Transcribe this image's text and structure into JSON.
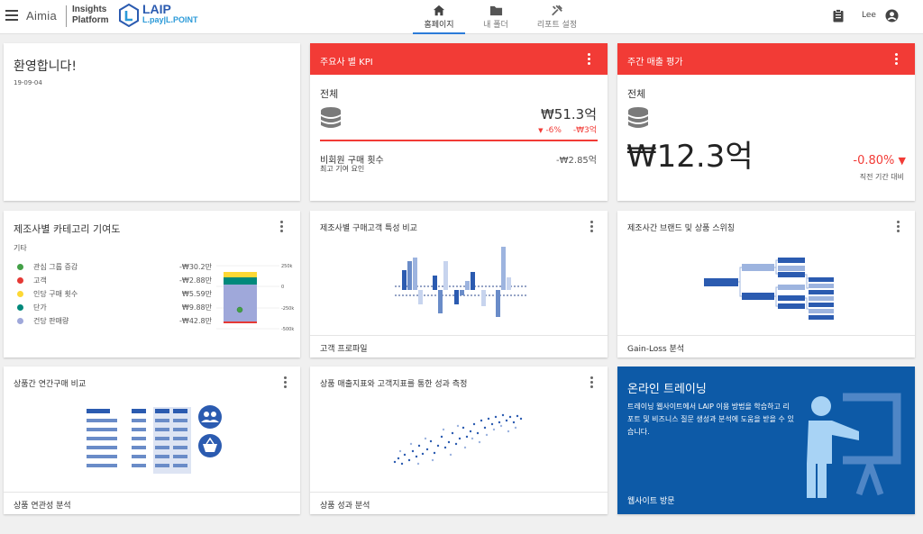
{
  "header": {
    "brand_left": "Aimia",
    "brand_mid_line1": "Insights",
    "brand_mid_line2": "Platform",
    "logo_title": "LAIP",
    "logo_sub": "L.pay|L.POINT",
    "tabs": [
      {
        "label": "홈페이지",
        "icon": "home-icon",
        "active": true
      },
      {
        "label": "내 폴더",
        "icon": "folder-icon",
        "active": false
      },
      {
        "label": "리포트 설정",
        "icon": "report-settings-icon",
        "active": false
      }
    ],
    "user": "Lee"
  },
  "welcome": {
    "title": "환영합니다!",
    "date": "19-09-04"
  },
  "kpi": {
    "title": "주요사 별 KPI",
    "scope": "전체",
    "value": "₩51.3억",
    "change_pct": "-6%",
    "change_abs": "-₩3억",
    "metric_label": "비회원 구매 횟수",
    "metric_value": "-₩2.85억",
    "metric_sub": "최고 기여 요인"
  },
  "weekly": {
    "title": "주간 매출 평가",
    "scope": "전체",
    "value": "₩12.3억",
    "change": "-0.80%",
    "compare": "직전 기간 대비"
  },
  "category": {
    "title": "제조사별 카테고리 기여도",
    "subtitle": "기타",
    "items": [
      {
        "label": "관심 그룹 증감",
        "value": "-₩30.2만",
        "color": "#43a047"
      },
      {
        "label": "고객",
        "value": "-₩2.88만",
        "color": "#e53935"
      },
      {
        "label": "인당 구매 횟수",
        "value": "₩5.59만",
        "color": "#fdd835"
      },
      {
        "label": "단가",
        "value": "₩9.88만",
        "color": "#00897b"
      },
      {
        "label": "건당 판매량",
        "value": "-₩42.8만",
        "color": "#9fa8da"
      }
    ],
    "axis": [
      "250k",
      "0",
      "-250k",
      "-500k"
    ]
  },
  "customer_compare": {
    "title": "제조사별 구매고객 특성 비교",
    "footer": "고객 프로파일"
  },
  "brand_switch": {
    "title": "제조사간 브랜드 및 상품 스위칭",
    "footer": "Gain-Loss 분석"
  },
  "basket": {
    "title": "상품간 연간구매 비교",
    "footer": "상품 연관성 분석"
  },
  "performance": {
    "title": "상품 매출지표와 고객지표를 통한 성과 측정",
    "footer": "상품 성과 분석"
  },
  "training": {
    "title": "온라인 트레이닝",
    "body": "트레이닝 웹사이트에서 LAIP 이용 방법을 학습하고 리포트 및 비즈니스 질문 생성과 분석에 도움을 받을 수 있습니다.",
    "link": "웹사이트 방문"
  },
  "colors": {
    "red": "#f23b36",
    "blue_dark": "#2b5bb0",
    "training_bg": "#0d5aa7",
    "accent": "#2b7bd8"
  }
}
